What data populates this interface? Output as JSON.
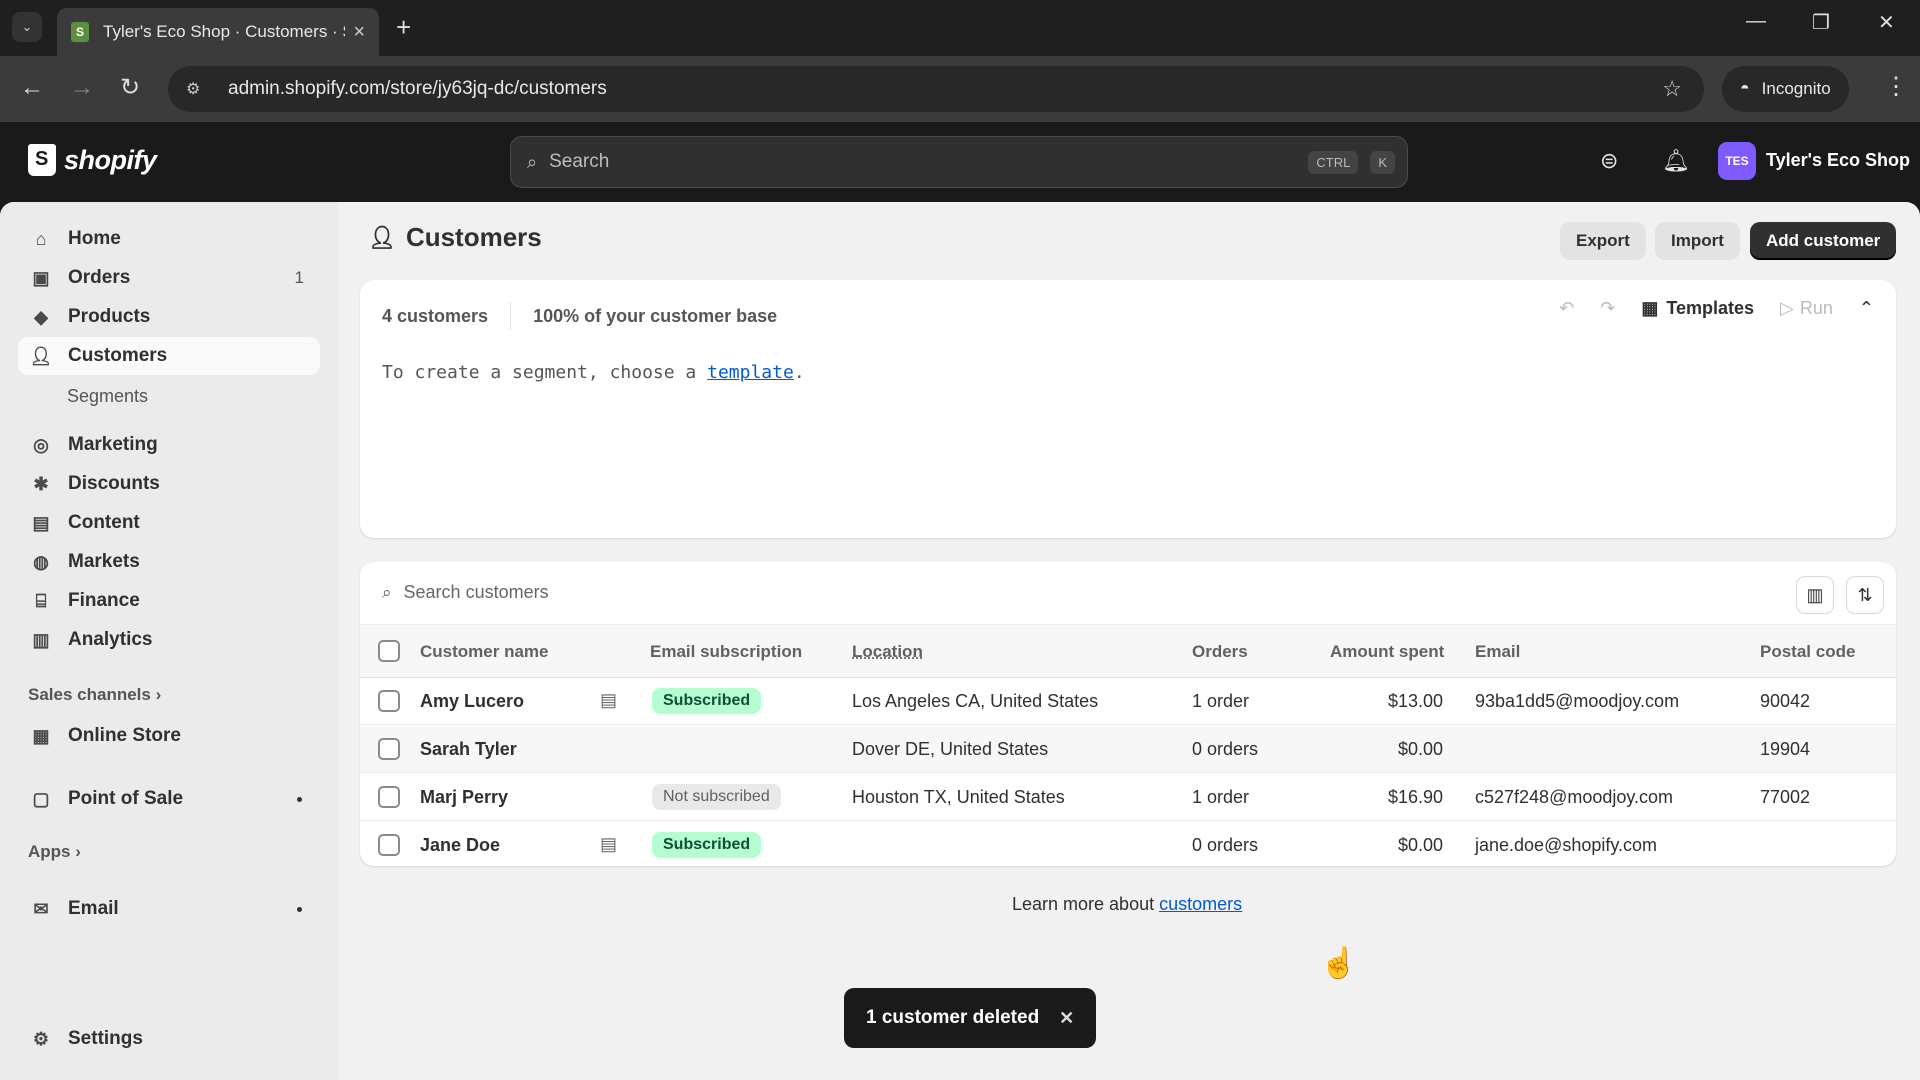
{
  "browser": {
    "tab_title": "Tyler's Eco Shop · Customers · S",
    "url": "admin.shopify.com/store/jy63jq-dc/customers",
    "incognito_label": "Incognito"
  },
  "topbar": {
    "logo_text": "shopify",
    "search_placeholder": "Search",
    "shortcut_ctrl": "CTRL",
    "shortcut_k": "K",
    "store_initials": "TES",
    "store_name": "Tyler's Eco Shop"
  },
  "sidebar": {
    "items": [
      {
        "label": "Home",
        "icon": "home-icon"
      },
      {
        "label": "Orders",
        "icon": "orders-icon",
        "count": "1"
      },
      {
        "label": "Products",
        "icon": "tag-icon"
      },
      {
        "label": "Customers",
        "icon": "person-icon"
      },
      {
        "label": "Marketing",
        "icon": "target-icon"
      },
      {
        "label": "Discounts",
        "icon": "discount-icon"
      },
      {
        "label": "Content",
        "icon": "content-icon"
      },
      {
        "label": "Markets",
        "icon": "globe-icon"
      },
      {
        "label": "Finance",
        "icon": "bank-icon"
      },
      {
        "label": "Analytics",
        "icon": "bar-chart-icon"
      }
    ],
    "segments_label": "Segments",
    "sales_channels_label": "Sales channels",
    "online_store_label": "Online Store",
    "point_of_sale_label": "Point of Sale",
    "apps_label": "Apps",
    "email_label": "Email",
    "settings_label": "Settings"
  },
  "page": {
    "title": "Customers",
    "export_label": "Export",
    "import_label": "Import",
    "add_customer_label": "Add customer"
  },
  "segment": {
    "count_text": "4 customers",
    "base_text": "100% of your customer base",
    "templates_label": "Templates",
    "run_label": "Run",
    "hint_prefix": "To create a segment, choose a",
    "hint_link": "template",
    "hint_suffix": "."
  },
  "customers": {
    "search_placeholder": "Search customers",
    "columns": [
      "Customer name",
      "Email subscription",
      "Location",
      "Orders",
      "Amount spent",
      "Email",
      "Postal code"
    ],
    "rows": [
      {
        "name": "Amy Lucero",
        "note": true,
        "subscription": "Subscribed",
        "location": "Los Angeles CA, United States",
        "orders": "1 order",
        "amount": "$13.00",
        "email": "93ba1dd5@moodjoy.com",
        "postal": "90042"
      },
      {
        "name": "Sarah Tyler",
        "note": false,
        "subscription": "",
        "location": "Dover DE, United States",
        "orders": "0 orders",
        "amount": "$0.00",
        "email": "",
        "postal": "19904"
      },
      {
        "name": "Marj Perry",
        "note": false,
        "subscription": "Not subscribed",
        "location": "Houston TX, United States",
        "orders": "1 order",
        "amount": "$16.90",
        "email": "c527f248@moodjoy.com",
        "postal": "77002"
      },
      {
        "name": "Jane Doe",
        "note": true,
        "subscription": "Subscribed",
        "location": "",
        "orders": "0 orders",
        "amount": "$0.00",
        "email": "jane.doe@shopify.com",
        "postal": ""
      }
    ]
  },
  "footer": {
    "learn_prefix": "Learn more about",
    "learn_link": "customers"
  },
  "toast": {
    "message": "1 customer deleted"
  },
  "colors": {
    "subscribed_bg": "#b4fed2",
    "primary_button": "#303030",
    "link": "#005bd3",
    "store_badge": "#7f5bff"
  }
}
